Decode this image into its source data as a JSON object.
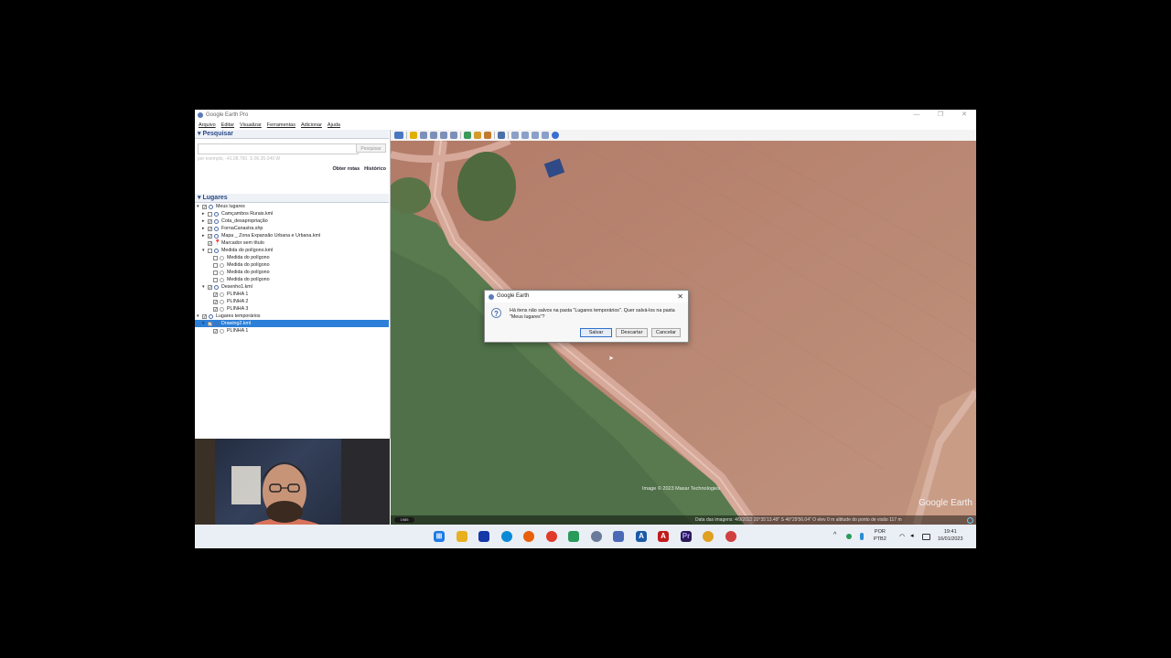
{
  "window": {
    "title": "Google Earth Pro",
    "controls": [
      "—",
      "❐",
      "✕"
    ]
  },
  "menu": [
    "Arquivo",
    "Editar",
    "Visualizar",
    "Ferramentas",
    "Adicionar",
    "Ajuda"
  ],
  "search": {
    "header": "Pesquisar",
    "placeholder": "",
    "button": "Pesquisar",
    "hint": "por exemplo, -41.08.760, S 06.35.049 W",
    "links": [
      "Obter rotas",
      "Histórico"
    ]
  },
  "places": {
    "header": "Lugares",
    "items": [
      {
        "label": "Meus lugares",
        "level": 0,
        "expanded": true,
        "checked": true,
        "icon": "globe"
      },
      {
        "label": "Camçambos Rurais.kml",
        "level": 1,
        "expanded": false,
        "checked": false,
        "icon": "globe"
      },
      {
        "label": "Cota_desapropriação",
        "level": 1,
        "expanded": false,
        "checked": true,
        "icon": "globe"
      },
      {
        "label": "FornaCanastra.shp",
        "level": 1,
        "expanded": false,
        "checked": true,
        "icon": "globe"
      },
      {
        "label": "Mapa _ Zona Expansão Urbana e Urbana.kml",
        "level": 1,
        "expanded": false,
        "checked": true,
        "icon": "globe"
      },
      {
        "label": "Marcador sem título",
        "level": 1,
        "expanded": null,
        "checked": true,
        "icon": "pin"
      },
      {
        "label": "Medida do polígono.kml",
        "level": 1,
        "expanded": true,
        "checked": false,
        "icon": "globe"
      },
      {
        "label": "Medida do polígono",
        "level": 2,
        "expanded": null,
        "checked": false,
        "icon": "poly"
      },
      {
        "label": "Medida do polígono",
        "level": 2,
        "expanded": null,
        "checked": false,
        "icon": "poly"
      },
      {
        "label": "Medida do polígono",
        "level": 2,
        "expanded": null,
        "checked": false,
        "icon": "poly"
      },
      {
        "label": "Medida do polígono",
        "level": 2,
        "expanded": null,
        "checked": false,
        "icon": "poly"
      },
      {
        "label": "Desenho1.kml",
        "level": 1,
        "expanded": true,
        "checked": true,
        "icon": "globe"
      },
      {
        "label": "PLINHA 1",
        "level": 2,
        "expanded": null,
        "checked": true,
        "icon": "poly"
      },
      {
        "label": "PLINHA 2",
        "level": 2,
        "expanded": null,
        "checked": true,
        "icon": "poly"
      },
      {
        "label": "PLINHA 3",
        "level": 2,
        "expanded": null,
        "checked": true,
        "icon": "poly"
      },
      {
        "label": "Lugares temporários",
        "level": 0,
        "expanded": true,
        "checked": true,
        "icon": "globe"
      },
      {
        "label": "Drawing2.kml",
        "level": 1,
        "expanded": true,
        "checked": true,
        "icon": "globe",
        "selected": true
      },
      {
        "label": "PLINHA 1",
        "level": 2,
        "expanded": null,
        "checked": true,
        "icon": "poly"
      }
    ]
  },
  "dialog": {
    "title": "Google Earth",
    "close": "✕",
    "icon": "question-icon",
    "message": "Há itens não salvos na pasta \"Lugares temporários\". Quer salvá-los na pasta \"Meus lugares\"?",
    "buttons": [
      "Salvar",
      "Descartar",
      "Cancelar"
    ]
  },
  "map": {
    "copyright": "Image © 2023 Maxar Technologies",
    "logo": "Google Earth",
    "scale": "1985",
    "status": "Data das imagens: 4/9/2022    20°35'13.49\" S    46°29'56.04\" O    elev    0 m    altitude do ponto de visão    117 m"
  },
  "taskbar": {
    "lang_top": "POR",
    "lang_bottom": "PTB2",
    "time": "19:41",
    "date": "16/01/2023",
    "tray_chevron": "^"
  },
  "colors": {
    "selection": "#2c7fd8",
    "map_field": "#b9816d",
    "map_green": "#5a7d50"
  }
}
